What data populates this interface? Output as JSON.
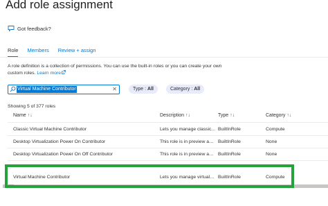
{
  "header": {
    "title": "Add role assignment",
    "more": "···"
  },
  "feedback": {
    "label": "Got feedback?",
    "icon": "feedback-icon"
  },
  "tabs": [
    {
      "label": "Role"
    },
    {
      "label": "Members"
    },
    {
      "label": "Review + assign"
    }
  ],
  "description": {
    "text": "A role definition is a collection of permissions. You can use the built-in roles or you can create your own custom roles.",
    "link": "Learn more"
  },
  "search": {
    "value": "Virtual Machine Contributor",
    "icon": "search-icon",
    "clear": "✕"
  },
  "filters": {
    "type": {
      "label": "Type :",
      "value": "All"
    },
    "category": {
      "label": "Category :",
      "value": "All"
    }
  },
  "results": {
    "count_text": "Showing 5 of 377 roles"
  },
  "table": {
    "columns": [
      "Name",
      "Description",
      "Type",
      "Category"
    ],
    "sort_glyph": "↑↓",
    "rows": [
      {
        "name": "Classic Virtual Machine Contributor",
        "description": "Lets you manage classic…",
        "type": "BuiltInRole",
        "category": "Compute"
      },
      {
        "name": "Desktop Virtualization Power On Contributor",
        "description": "This role is in preview a…",
        "type": "BuiltInRole",
        "category": "None"
      },
      {
        "name": "Desktop Virtualization Power On Off Contributor",
        "description": "This role is in preview a…",
        "type": "BuiltInRole",
        "category": "None"
      },
      {
        "name": "Virtual Machine Contributor",
        "description": "Lets you manage virtual…",
        "type": "BuiltInRole",
        "category": "Compute"
      }
    ]
  },
  "colors": {
    "accent": "#0078d4",
    "highlight": "#22a43a",
    "pill_bg": "#e8ebfa"
  }
}
